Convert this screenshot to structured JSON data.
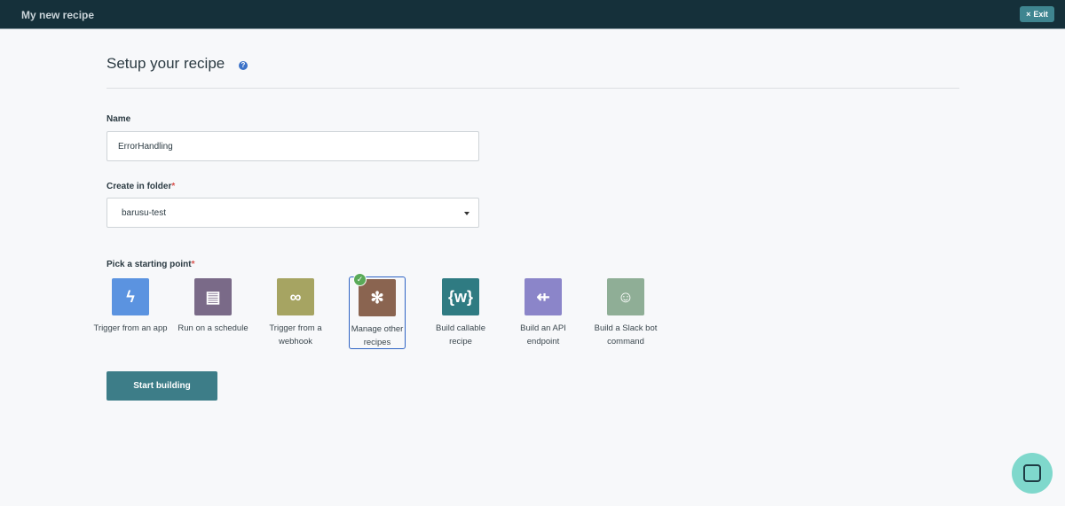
{
  "header": {
    "title": "My new recipe",
    "exit_label": "Exit"
  },
  "page": {
    "title": "Setup your recipe",
    "help_icon": "?"
  },
  "form": {
    "name_label": "Name",
    "name_value": "ErrorHandling",
    "folder_label": "Create in folder",
    "folder_required": "*",
    "folder_value": "barusu-test",
    "starting_label": "Pick a starting point",
    "starting_required": "*"
  },
  "tiles": [
    {
      "label": "Trigger from an app",
      "glyph": "ϟ",
      "color": "#5b93e0"
    },
    {
      "label": "Run on a schedule",
      "glyph": "▤",
      "color": "#7a6a88"
    },
    {
      "label": "Trigger from a webhook",
      "glyph": "∞",
      "color": "#a6a462"
    },
    {
      "label": "Manage other recipes",
      "glyph": "✻",
      "color": "#8a6450",
      "selected": true
    },
    {
      "label": "Build callable recipe",
      "glyph": "{w}",
      "color": "#2f7b82"
    },
    {
      "label": "Build an API endpoint",
      "glyph": "⇷",
      "color": "#8b85c9"
    },
    {
      "label": "Build a Slack bot command",
      "glyph": "☺",
      "color": "#8fae96"
    }
  ],
  "start_label": "Start building"
}
